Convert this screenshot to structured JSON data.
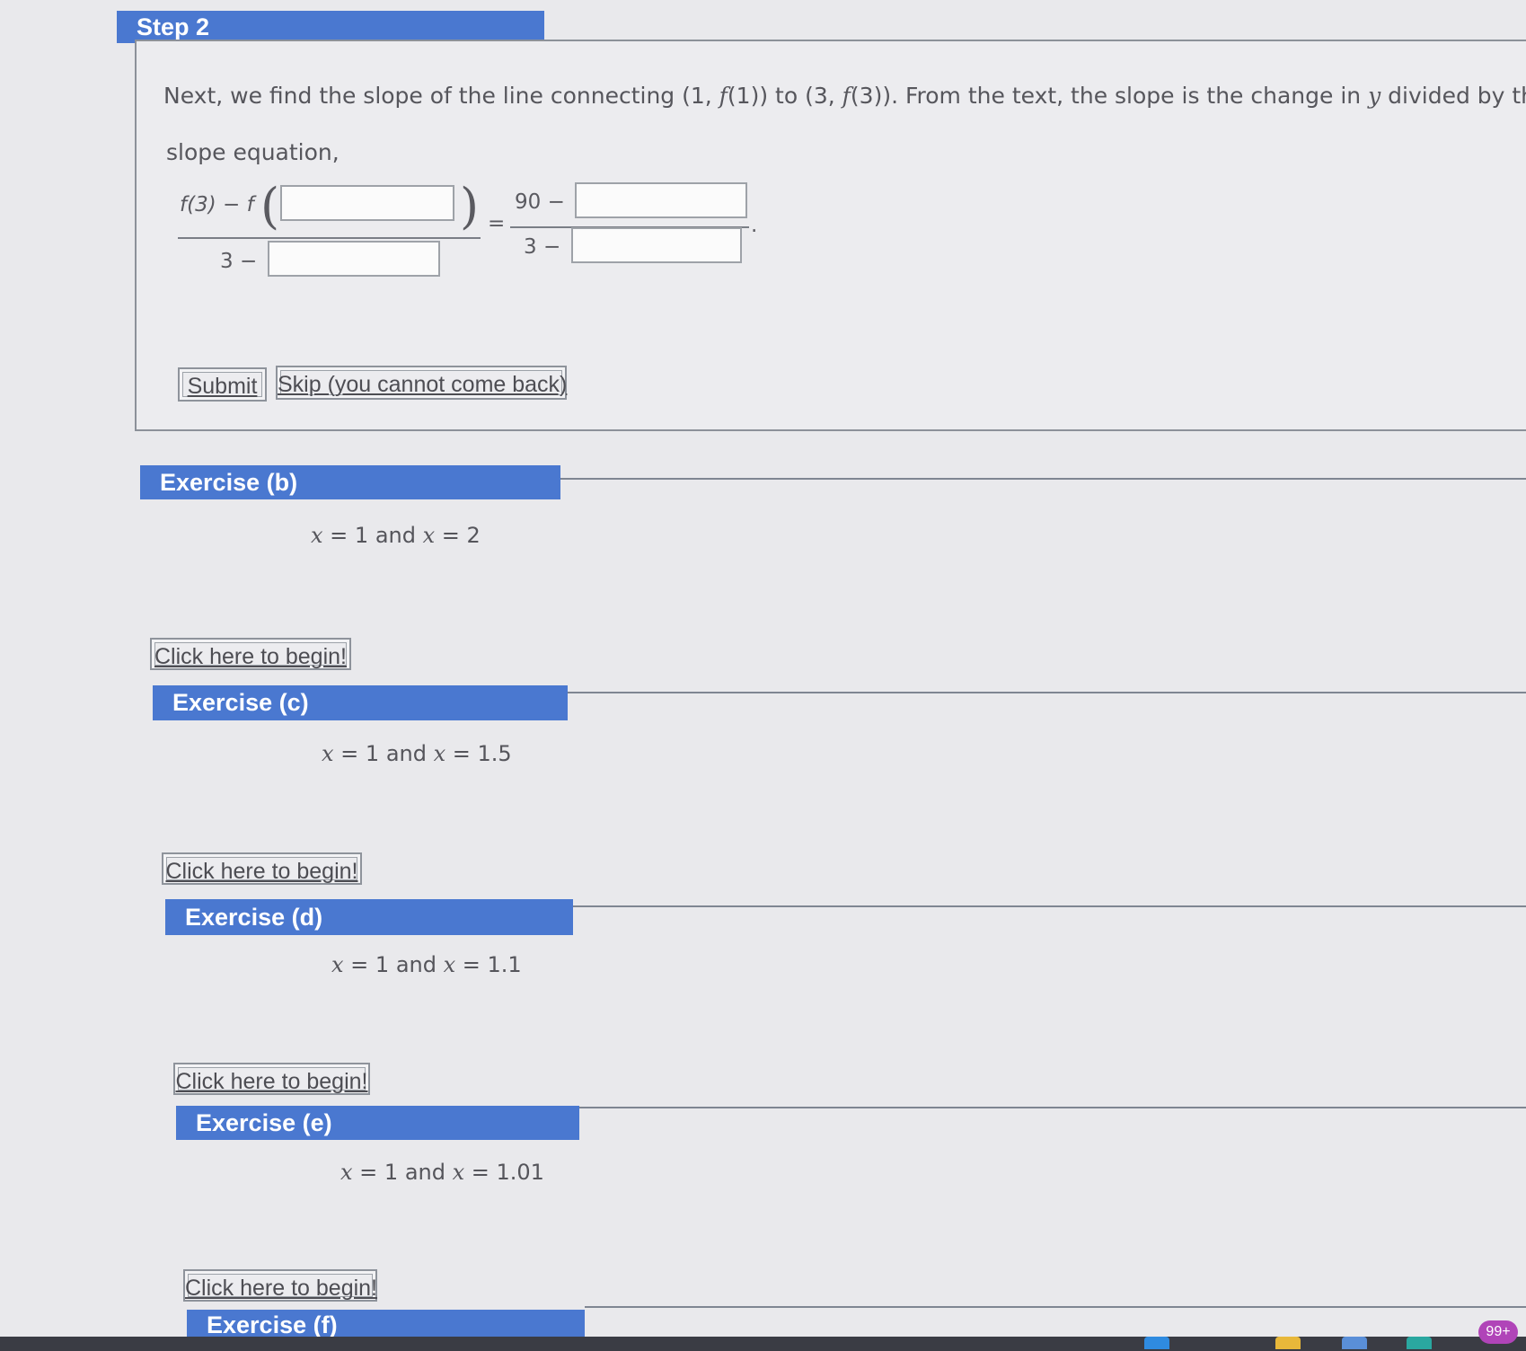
{
  "step": {
    "title": "Step 2",
    "intro_prefix": "Next, we find the slope of the line connecting (1, ",
    "intro_f1": "f",
    "intro_mid1": "(1)) to (3, ",
    "intro_f3": "f",
    "intro_mid2": "(3)). From the text, the slope is the change in ",
    "intro_y": "y",
    "intro_suffix": " divided by the cha",
    "line2": "slope equation,",
    "eq_left_num_prefix": "f(3) − f",
    "eq_left_den_prefix": "3 −",
    "eq_equals": "=",
    "eq_right_num_prefix": "90 −",
    "eq_right_den_prefix": "3 −",
    "eq_period": ".",
    "submit_label": "Submit",
    "skip_label": "Skip (you cannot come back)"
  },
  "exercises": [
    {
      "title": "Exercise (b)",
      "expr_x1": "x",
      "expr_mid": " = 1 and ",
      "expr_x2": "x",
      "expr_val": " = 2",
      "button": "Click here to begin!"
    },
    {
      "title": "Exercise (c)",
      "expr_x1": "x",
      "expr_mid": " = 1 and ",
      "expr_x2": "x",
      "expr_val": " = 1.5",
      "button": "Click here to begin!"
    },
    {
      "title": "Exercise (d)",
      "expr_x1": "x",
      "expr_mid": " = 1 and ",
      "expr_x2": "x",
      "expr_val": " = 1.1",
      "button": "Click here to begin!"
    },
    {
      "title": "Exercise (e)",
      "expr_x1": "x",
      "expr_mid": " = 1 and ",
      "expr_x2": "x",
      "expr_val": " = 1.01",
      "button": "Click here to begin!"
    },
    {
      "title": "Exercise (f)"
    }
  ],
  "taskbar": {
    "badge": "99+",
    "icons": [
      "chrome-icon",
      "folder-icon",
      "store-icon",
      "edge-icon"
    ]
  },
  "colors": {
    "header_blue": "#4a78d0",
    "background": "#e9e9ec",
    "badge": "#b044b8"
  }
}
